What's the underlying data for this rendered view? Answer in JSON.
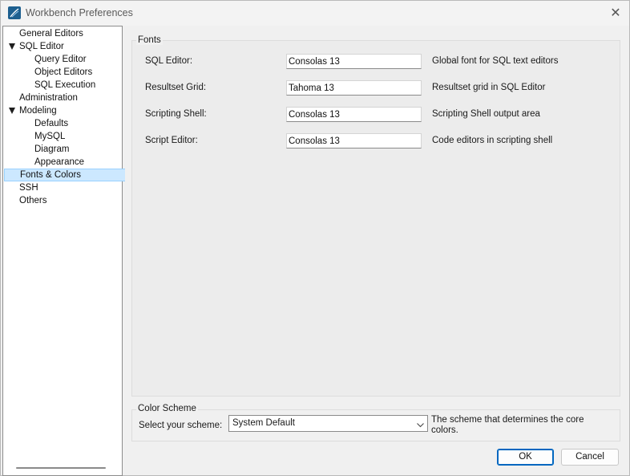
{
  "window": {
    "title": "Workbench Preferences",
    "close_symbol": "✕"
  },
  "tree": {
    "items": [
      {
        "label": "General Editors"
      },
      {
        "label": "SQL Editor"
      },
      {
        "label": "Query Editor"
      },
      {
        "label": "Object Editors"
      },
      {
        "label": "SQL Execution"
      },
      {
        "label": "Administration"
      },
      {
        "label": "Modeling"
      },
      {
        "label": "Defaults"
      },
      {
        "label": "MySQL"
      },
      {
        "label": "Diagram"
      },
      {
        "label": "Appearance"
      },
      {
        "label": "Fonts & Colors"
      },
      {
        "label": "SSH"
      },
      {
        "label": "Others"
      }
    ],
    "selected": "Fonts & Colors"
  },
  "fonts": {
    "legend": "Fonts",
    "rows": [
      {
        "label": "SQL Editor:",
        "value": "Consolas 13",
        "description": "Global font for SQL text editors"
      },
      {
        "label": "Resultset Grid:",
        "value": "Tahoma 13",
        "description": "Resultset grid in SQL Editor"
      },
      {
        "label": "Scripting Shell:",
        "value": "Consolas 13",
        "description": "Scripting Shell output area"
      },
      {
        "label": "Script Editor:",
        "value": "Consolas 13",
        "description": "Code editors in scripting shell"
      }
    ]
  },
  "color_scheme": {
    "legend": "Color Scheme",
    "label": "Select your scheme:",
    "value": "System Default",
    "description_line1": "The scheme that determines the core",
    "description_line2": "colors."
  },
  "buttons": {
    "ok": "OK",
    "cancel": "Cancel"
  },
  "colors": {
    "selection_bg": "#cce8ff",
    "selection_border": "#99d1ff",
    "default_button_border": "#0067c0",
    "app_icon": "#1d5f8f"
  }
}
